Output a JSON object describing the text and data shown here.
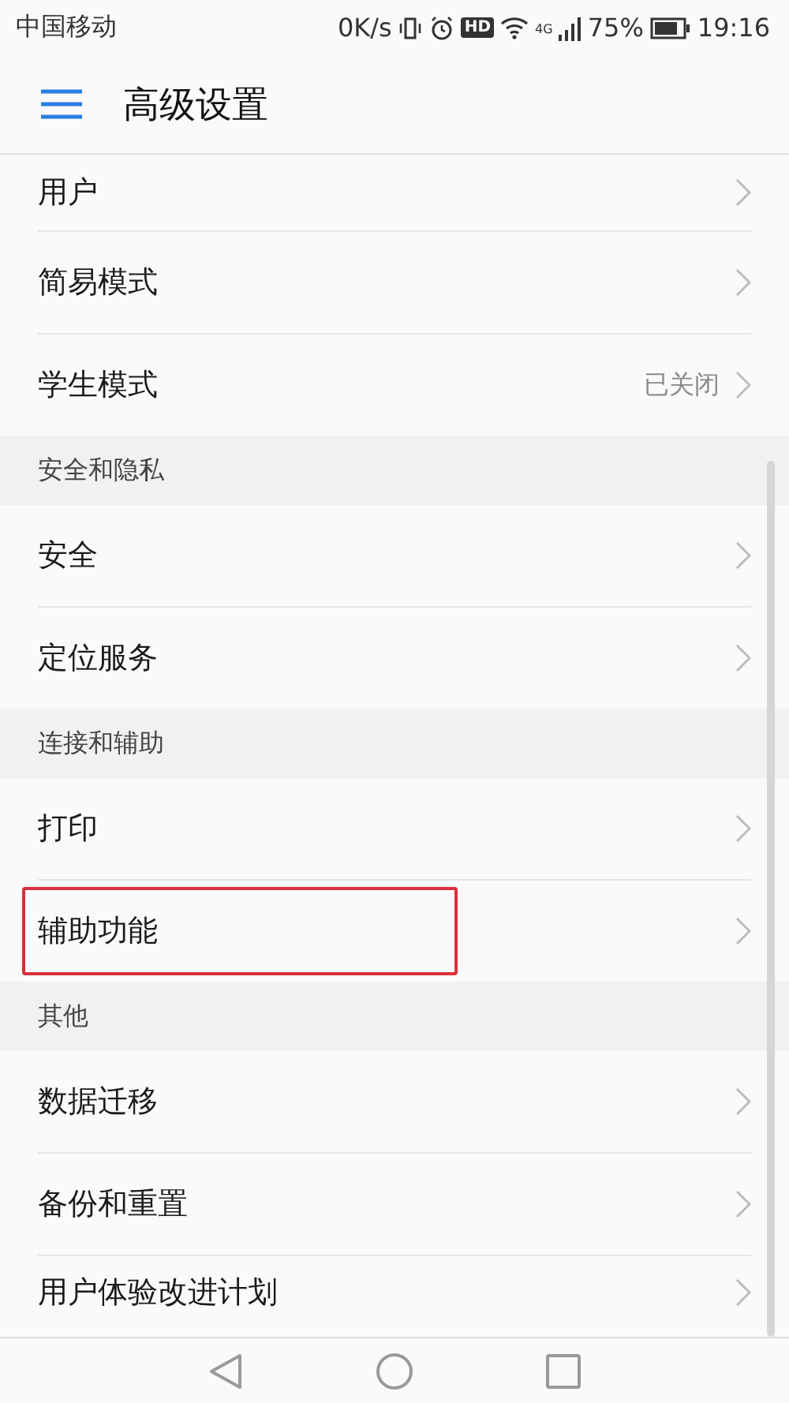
{
  "status_bar": {
    "carrier": "中国移动",
    "speed": "0K/s",
    "hd": "HD",
    "network": "4G",
    "battery": "75%",
    "time": "19:16"
  },
  "header": {
    "title": "高级设置"
  },
  "list": [
    {
      "kind": "item",
      "label": "用户",
      "highlighted": false
    },
    {
      "kind": "item",
      "label": "简易模式",
      "highlighted": false
    },
    {
      "kind": "item",
      "label": "学生模式",
      "value": "已关闭",
      "highlighted": false
    },
    {
      "kind": "section",
      "label": "安全和隐私"
    },
    {
      "kind": "item",
      "label": "安全",
      "highlighted": false
    },
    {
      "kind": "item",
      "label": "定位服务",
      "highlighted": false
    },
    {
      "kind": "section",
      "label": "连接和辅助"
    },
    {
      "kind": "item",
      "label": "打印",
      "highlighted": false
    },
    {
      "kind": "item",
      "label": "辅助功能",
      "highlighted": true
    },
    {
      "kind": "section",
      "label": "其他"
    },
    {
      "kind": "item",
      "label": "数据迁移",
      "highlighted": false
    },
    {
      "kind": "item",
      "label": "备份和重置",
      "highlighted": false
    },
    {
      "kind": "item",
      "label": "用户体验改进计划",
      "highlighted": false
    }
  ]
}
